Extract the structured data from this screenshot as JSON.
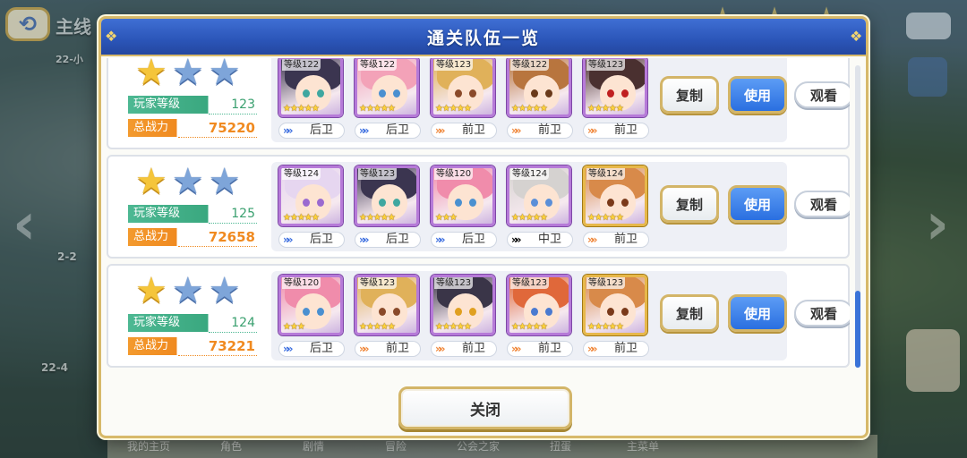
{
  "background": {
    "title_fragment": "主线",
    "subtitle_fragment": "22-小",
    "stage_labels": [
      "2-2",
      "22-4"
    ],
    "nav": [
      "我的主页",
      "角色",
      "剧情",
      "冒险",
      "公会之家",
      "扭蛋",
      "主菜单"
    ]
  },
  "dialog": {
    "title": "通关队伍一览",
    "close_label": "关闭"
  },
  "labels": {
    "player_level": "玩家等级",
    "total_power": "总战力",
    "copy": "复制",
    "use": "使用",
    "view": "观看"
  },
  "colors": {
    "header": "#2b55b8",
    "gold_border": "#d7b96a",
    "use_button": "#2a6fe0",
    "player_level": "#3aa87f",
    "total_power": "#f08a20",
    "back_line": "#3d6fe0",
    "front_line": "#f0873a",
    "middle_line": "#3aaa73"
  },
  "teams": [
    {
      "stars_earned": 1,
      "stars_total": 3,
      "player_level": "123",
      "total_power": "75220",
      "members": [
        {
          "level": "等级122",
          "rarity": "★★★★★",
          "position": "后卫",
          "line": "back",
          "hair": "#3b3550",
          "eye": "#3fa7a0",
          "frame": "purple"
        },
        {
          "level": "等级122",
          "rarity": "★★★★★",
          "position": "后卫",
          "line": "back",
          "hair": "#f3a2b8",
          "eye": "#4a90d0",
          "frame": "purple"
        },
        {
          "level": "等级123",
          "rarity": "★★★★★",
          "position": "前卫",
          "line": "front",
          "hair": "#e0b15a",
          "eye": "#8a4a2a",
          "frame": "purple"
        },
        {
          "level": "等级122",
          "rarity": "★★★★★",
          "position": "前卫",
          "line": "front",
          "hair": "#b8753e",
          "eye": "#6a3a1a",
          "frame": "purple"
        },
        {
          "level": "等级123",
          "rarity": "★★★★★",
          "position": "前卫",
          "line": "front",
          "hair": "#4a3030",
          "eye": "#c02020",
          "frame": "purple"
        }
      ]
    },
    {
      "stars_earned": 1,
      "stars_total": 3,
      "player_level": "125",
      "total_power": "72658",
      "members": [
        {
          "level": "等级124",
          "rarity": "★★★★★",
          "position": "后卫",
          "line": "back",
          "hair": "#e6d6f0",
          "eye": "#9a6ad0",
          "frame": "purple"
        },
        {
          "level": "等级123",
          "rarity": "★★★★★",
          "position": "后卫",
          "line": "back",
          "hair": "#3b3550",
          "eye": "#3fa7a0",
          "frame": "purple"
        },
        {
          "level": "等级120",
          "rarity": "★★★",
          "position": "后卫",
          "line": "back",
          "hair": "#f08cab",
          "eye": "#4a90d0",
          "frame": "purple"
        },
        {
          "level": "等级124",
          "rarity": "★★★★★",
          "position": "中卫",
          "line": "middle",
          "hair": "#d5d2d0",
          "eye": "#5a8fd8",
          "frame": "purple"
        },
        {
          "level": "等级124",
          "rarity": "★★★★★",
          "position": "前卫",
          "line": "front",
          "hair": "#d88a4a",
          "eye": "#7a3a1a",
          "frame": "gold"
        }
      ]
    },
    {
      "stars_earned": 1,
      "stars_total": 3,
      "player_level": "124",
      "total_power": "73221",
      "members": [
        {
          "level": "等级120",
          "rarity": "★★★",
          "position": "后卫",
          "line": "back",
          "hair": "#f08cab",
          "eye": "#4a90d0",
          "frame": "purple"
        },
        {
          "level": "等级123",
          "rarity": "★★★★★",
          "position": "前卫",
          "line": "front",
          "hair": "#e0b15a",
          "eye": "#8a4a2a",
          "frame": "purple"
        },
        {
          "level": "等级123",
          "rarity": "★★★★★",
          "position": "前卫",
          "line": "front",
          "hair": "#3a3548",
          "eye": "#e0a020",
          "frame": "purple"
        },
        {
          "level": "等级123",
          "rarity": "★★★★★",
          "position": "前卫",
          "line": "front",
          "hair": "#e0683a",
          "eye": "#4a7ad0",
          "frame": "purple"
        },
        {
          "level": "等级123",
          "rarity": "★★★★★",
          "position": "前卫",
          "line": "front",
          "hair": "#d88a4a",
          "eye": "#7a3a1a",
          "frame": "gold"
        }
      ]
    }
  ]
}
